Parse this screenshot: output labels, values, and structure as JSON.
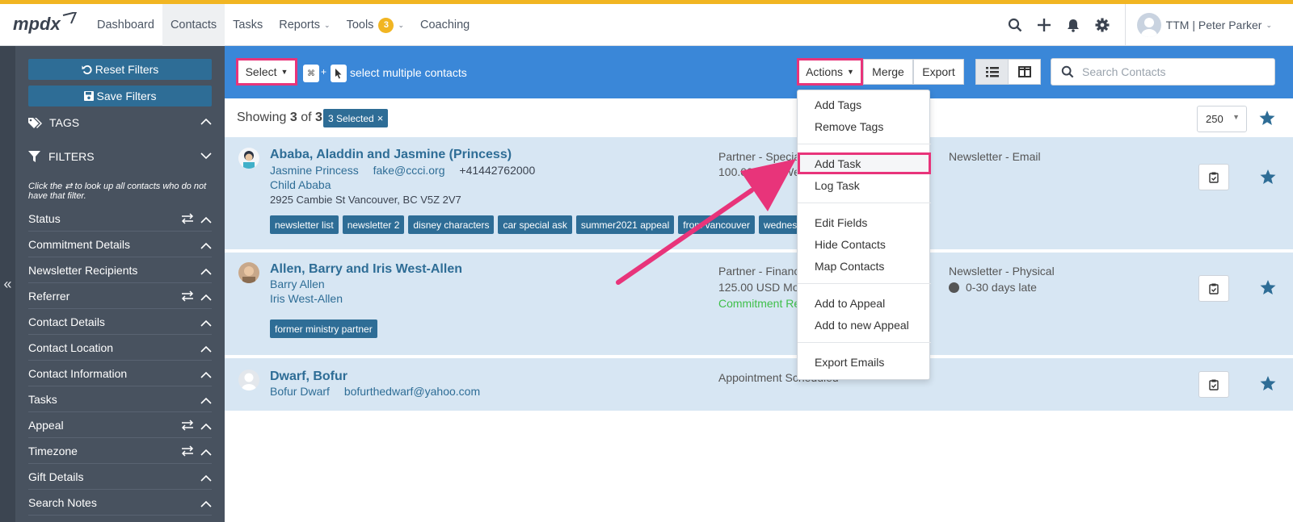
{
  "nav": {
    "items": [
      "Dashboard",
      "Contacts",
      "Tasks",
      "Reports",
      "Tools",
      "Coaching"
    ],
    "tools_badge": "3",
    "user": "TTM | Peter Parker"
  },
  "sidebar": {
    "reset_filters": "Reset Filters",
    "save_filters": "Save Filters",
    "tags_heading": "TAGS",
    "filters_heading": "FILTERS",
    "hint": "Click the ⇄ to look up all contacts who do not have that filter.",
    "filters": [
      {
        "label": "Status",
        "reversible": true
      },
      {
        "label": "Commitment Details",
        "reversible": false
      },
      {
        "label": "Newsletter Recipients",
        "reversible": false
      },
      {
        "label": "Referrer",
        "reversible": true
      },
      {
        "label": "Contact Details",
        "reversible": false
      },
      {
        "label": "Contact Location",
        "reversible": false
      },
      {
        "label": "Contact Information",
        "reversible": false
      },
      {
        "label": "Tasks",
        "reversible": false
      },
      {
        "label": "Appeal",
        "reversible": true
      },
      {
        "label": "Timezone",
        "reversible": true
      },
      {
        "label": "Gift Details",
        "reversible": false
      },
      {
        "label": "Search Notes",
        "reversible": false
      }
    ]
  },
  "toolbar": {
    "select_label": "Select",
    "multi_hint": "select multiple contacts",
    "key_symbol": "⌘",
    "key_plus": "+",
    "actions_label": "Actions",
    "merge_label": "Merge",
    "export_label": "Export",
    "search_placeholder": "Search Contacts"
  },
  "summary": {
    "showing_prefix": "Showing",
    "shown": "3",
    "of_word": "of",
    "total": "3",
    "selected_badge": "3 Selected",
    "per_page": "250"
  },
  "contacts": [
    {
      "name": "Ababa, Aladdin and Jasmine (Princess)",
      "person": "Jasmine Princess",
      "email": "fake@ccci.org",
      "phone": "+41442762000",
      "child": "Child Ababa",
      "address": "2925 Cambie St Vancouver, BC V5Z 2V7",
      "tags": [
        "newsletter list",
        "newsletter 2",
        "disney characters",
        "car special ask",
        "summer2021 appeal",
        "from vancouver",
        "wednesday bible"
      ],
      "status": "Partner - Special",
      "commitment": "100.00 USD Weekly",
      "newsletter": "Newsletter - Email"
    },
    {
      "name": "Allen, Barry and Iris West-Allen",
      "person": "Barry Allen",
      "person2": "Iris West-Allen",
      "tags": [
        "former ministry partner"
      ],
      "status": "Partner - Financial",
      "commitment": "125.00 USD Monthly",
      "commitment_status": "Commitment Received",
      "newsletter": "Newsletter - Physical",
      "late": "0-30 days late"
    },
    {
      "name": "Dwarf, Bofur",
      "person": "Bofur Dwarf",
      "email": "bofurthedwarf@yahoo.com",
      "status": "Appointment Scheduled"
    }
  ],
  "actions_menu": {
    "groups": [
      [
        "Add Tags",
        "Remove Tags"
      ],
      [
        "Add Task",
        "Log Task"
      ],
      [
        "Edit Fields",
        "Hide Contacts",
        "Map Contacts"
      ],
      [
        "Add to Appeal",
        "Add to new Appeal"
      ],
      [
        "Export Emails"
      ]
    ],
    "highlighted": "Add Task"
  },
  "colors": {
    "toolbar": "#3a87d8",
    "sidebar": "#48525f",
    "row": "#d7e6f3",
    "link": "#2e6d96",
    "highlight": "#e8347a",
    "accent": "#f1b522",
    "commitment_received": "#3fbf4a"
  }
}
